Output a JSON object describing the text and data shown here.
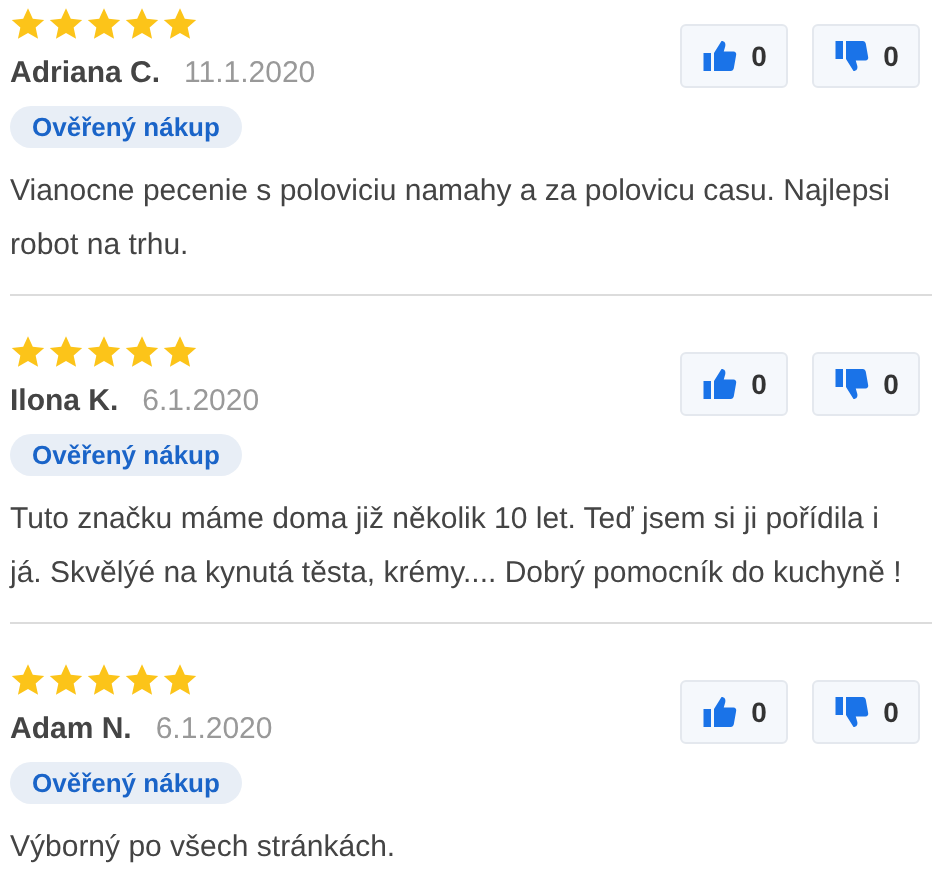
{
  "reviews": [
    {
      "stars": 5,
      "author": "Adriana C.",
      "date": "11.1.2020",
      "badge": "Ověřený nákup",
      "text": "Vianocne pecenie s poloviciu namahy a za polovicu casu. Najlepsi robot na trhu.",
      "likes": "0",
      "dislikes": "0"
    },
    {
      "stars": 5,
      "author": "Ilona K.",
      "date": "6.1.2020",
      "badge": "Ověřený nákup",
      "text": "Tuto značku máme doma již několik 10 let. Teď jsem si ji pořídila i já. Skvělýé na kynutá těsta, krémy.... Dobrý pomocník do kuchyně !",
      "likes": "0",
      "dislikes": "0"
    },
    {
      "stars": 5,
      "author": "Adam N.",
      "date": "6.1.2020",
      "badge": "Ověřený nákup",
      "text": "Výborný po všech stránkách.",
      "likes": "0",
      "dislikes": "0"
    }
  ]
}
